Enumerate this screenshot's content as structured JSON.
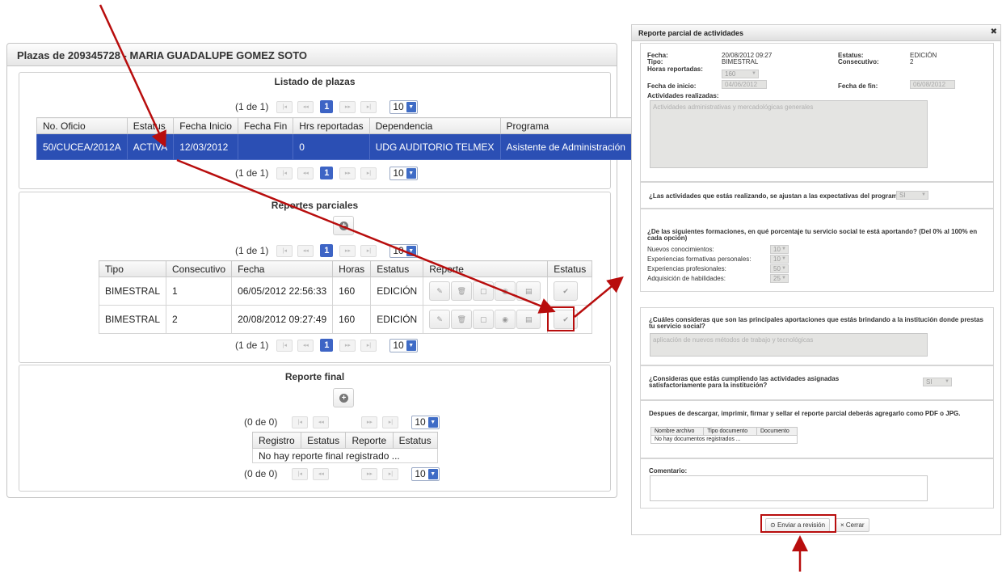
{
  "left": {
    "title": "Plazas de 209345728 - MARIA GUADALUPE GOMEZ SOTO",
    "plazas": {
      "title": "Listado de plazas",
      "pager_text": "(1 de 1)",
      "page": "1",
      "per_page": "10",
      "columns": [
        "No. Oficio",
        "Estatus",
        "Fecha Inicio",
        "Fecha Fin",
        "Hrs reportadas",
        "Dependencia",
        "Programa"
      ],
      "row": [
        "50/CUCEA/2012A",
        "ACTIVA",
        "12/03/2012",
        "",
        "0",
        "UDG AUDITORIO TELMEX",
        "Asistente de Administración"
      ]
    },
    "parciales": {
      "title": "Reportes parciales",
      "pager_text": "(1 de 1)",
      "page": "1",
      "per_page": "10",
      "columns": [
        "Tipo",
        "Consecutivo",
        "Fecha",
        "Horas",
        "Estatus",
        "Reporte",
        "Estatus"
      ],
      "rows": [
        [
          "BIMESTRAL",
          "1",
          "06/05/2012 22:56:33",
          "160",
          "EDICIÓN"
        ],
        [
          "BIMESTRAL",
          "2",
          "20/08/2012 09:27:49",
          "160",
          "EDICIÓN"
        ]
      ]
    },
    "final": {
      "title": "Reporte final",
      "pager_text": "(0 de 0)",
      "per_page": "10",
      "columns": [
        "Registro",
        "Estatus",
        "Reporte",
        "Estatus"
      ],
      "empty": "No hay reporte final registrado ..."
    }
  },
  "right": {
    "title": "Reporte parcial de actividades",
    "fecha_label": "Fecha:",
    "fecha_value": "20/08/2012 09:27",
    "tipo_label": "Tipo:",
    "tipo_value": "BIMESTRAL",
    "horas_label": "Horas reportadas:",
    "horas_value": "160",
    "estatus_label": "Estatus:",
    "estatus_value": "EDICIÓN",
    "consecutivo_label": "Consecutivo:",
    "consecutivo_value": "2",
    "inicio_label": "Fecha de inicio:",
    "inicio_value": "04/06/2012",
    "fin_label": "Fecha de fin:",
    "fin_value": "06/08/2012",
    "actividades_label": "Actividades realizadas:",
    "actividades_value": "Actividades administrativas y mercadológicas generales",
    "q1": "¿Las actividades que estás realizando, se ajustan a las expectativas del programa?",
    "q1_value": "SI",
    "q2": "¿De las siguientes formaciones, en qué porcentaje tu servicio social te está aportando? (Del 0% al 100% en cada opción)",
    "formaciones": [
      {
        "label": "Nuevos conocimientos:",
        "value": "10"
      },
      {
        "label": "Experiencias formativas personales:",
        "value": "10"
      },
      {
        "label": "Experiencias profesionales:",
        "value": "50"
      },
      {
        "label": "Adquisición de habilidades:",
        "value": "25"
      }
    ],
    "q3": "¿Cuáles consideras que son las principales aportaciones que estás brindando a la institución donde prestas tu servicio social?",
    "q3_value": "aplicación de nuevos métodos de trabajo y tecnológicas",
    "q4": "¿Consideras que estás cumpliendo las actividades asignadas satisfactoriamente para la institución?",
    "q4_value": "SI",
    "doc_note": "Despues de descargar, imprimir, firmar y sellar el reporte parcial deberás agregarlo como PDF o JPG.",
    "doc_columns": [
      "Nombre archivo",
      "Tipo documento",
      "Documento"
    ],
    "doc_empty": "No hay documentos registrados ...",
    "comentario_label": "Comentario:",
    "enviar": "Enviar a revisión",
    "cerrar": "Cerrar"
  },
  "colors": {
    "annotation": "#b80d0d",
    "selected_row": "#2b4fb4",
    "page_current": "#3d64c5"
  }
}
